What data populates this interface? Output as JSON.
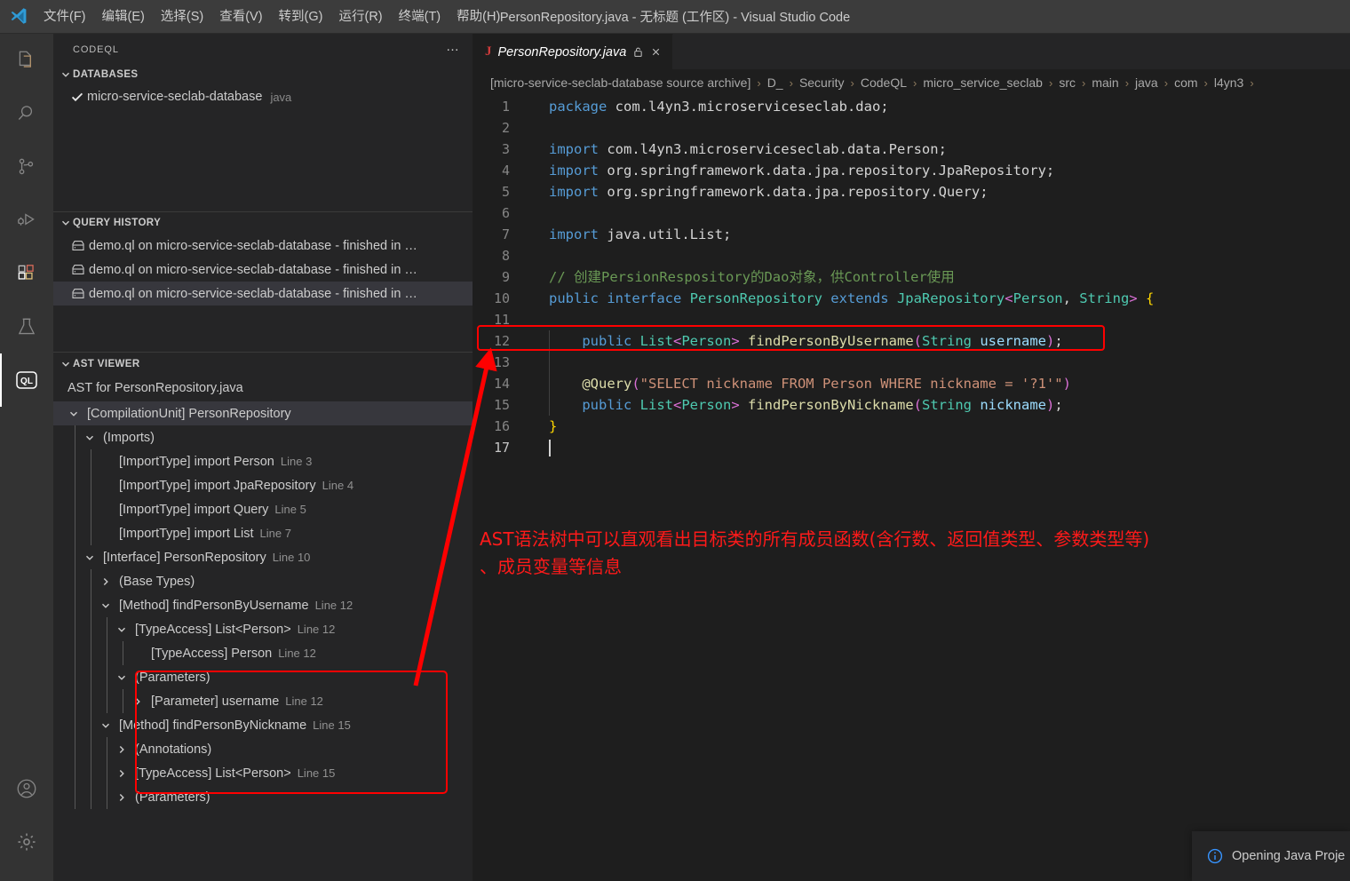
{
  "titlebar": {
    "logo_icon": "vscode-logo-icon",
    "menus": [
      {
        "label": "文件(F)",
        "name": "menu-file"
      },
      {
        "label": "编辑(E)",
        "name": "menu-edit"
      },
      {
        "label": "选择(S)",
        "name": "menu-selection"
      },
      {
        "label": "查看(V)",
        "name": "menu-view"
      },
      {
        "label": "转到(G)",
        "name": "menu-go"
      },
      {
        "label": "运行(R)",
        "name": "menu-run"
      },
      {
        "label": "终端(T)",
        "name": "menu-terminal"
      },
      {
        "label": "帮助(H)",
        "name": "menu-help"
      }
    ],
    "title": "PersonRepository.java - 无标题 (工作区) - Visual Studio Code"
  },
  "activitybar": {
    "items": [
      {
        "icon": "explorer-files-icon",
        "active": false
      },
      {
        "icon": "search-icon",
        "active": false
      },
      {
        "icon": "source-control-branch-icon",
        "active": false
      },
      {
        "icon": "run-and-debug-icon",
        "active": false
      },
      {
        "icon": "extensions-icon",
        "active": false
      },
      {
        "icon": "testing-beaker-icon",
        "active": false
      },
      {
        "icon": "codeql-icon",
        "active": true
      }
    ],
    "bottom_items": [
      {
        "icon": "account-icon"
      },
      {
        "icon": "settings-gear-icon"
      }
    ]
  },
  "sidebar": {
    "title": "CODEQL",
    "more_actions": "…",
    "databases": {
      "header": "DATABASES",
      "items": [
        {
          "name": "micro-service-seclab-database",
          "language": "java",
          "selected": true
        }
      ]
    },
    "query_history": {
      "header": "QUERY HISTORY",
      "items": [
        {
          "label": "demo.ql on micro-service-seclab-database - finished in …",
          "selected": false
        },
        {
          "label": "demo.ql on micro-service-seclab-database - finished in …",
          "selected": false
        },
        {
          "label": "demo.ql on micro-service-seclab-database - finished in …",
          "selected": true
        }
      ]
    },
    "ast_viewer": {
      "header": "AST VIEWER",
      "subtitle": "AST for PersonRepository.java",
      "nodes": [
        {
          "chev": "down",
          "indent": 0,
          "label": "[CompilationUnit] PersonRepository",
          "line": "",
          "selected": true
        },
        {
          "chev": "down",
          "indent": 1,
          "label": "(Imports)",
          "line": ""
        },
        {
          "chev": "none",
          "indent": 2,
          "label": "[ImportType] import Person",
          "line": "Line 3"
        },
        {
          "chev": "none",
          "indent": 2,
          "label": "[ImportType] import JpaRepository",
          "line": "Line 4"
        },
        {
          "chev": "none",
          "indent": 2,
          "label": "[ImportType] import Query",
          "line": "Line 5"
        },
        {
          "chev": "none",
          "indent": 2,
          "label": "[ImportType] import List",
          "line": "Line 7"
        },
        {
          "chev": "down",
          "indent": 1,
          "label": "[Interface] PersonRepository",
          "line": "Line 10"
        },
        {
          "chev": "right",
          "indent": 2,
          "label": "(Base Types)",
          "line": ""
        },
        {
          "chev": "down",
          "indent": 2,
          "label": "[Method] findPersonByUsername",
          "line": "Line 12"
        },
        {
          "chev": "down",
          "indent": 3,
          "label": "[TypeAccess] List<Person>",
          "line": "Line 12"
        },
        {
          "chev": "none",
          "indent": 4,
          "label": "[TypeAccess] Person",
          "line": "Line 12"
        },
        {
          "chev": "down",
          "indent": 3,
          "label": "(Parameters)",
          "line": ""
        },
        {
          "chev": "right",
          "indent": 4,
          "label": "[Parameter] username",
          "line": "Line 12"
        },
        {
          "chev": "down",
          "indent": 2,
          "label": "[Method] findPersonByNickname",
          "line": "Line 15"
        },
        {
          "chev": "right",
          "indent": 3,
          "label": "(Annotations)",
          "line": ""
        },
        {
          "chev": "right",
          "indent": 3,
          "label": "[TypeAccess] List<Person>",
          "line": "Line 15"
        },
        {
          "chev": "right",
          "indent": 3,
          "label": "(Parameters)",
          "line": ""
        }
      ]
    }
  },
  "editor": {
    "tab": {
      "label": "PersonRepository.java",
      "file_icon": "java-file-icon",
      "pin_icon": "lock-icon",
      "close_icon": "close-icon"
    },
    "breadcrumb": [
      "[micro-service-seclab-database source archive]",
      "D_",
      "Security",
      "CodeQL",
      "micro_service_seclab",
      "src",
      "main",
      "java",
      "com",
      "l4yn3"
    ],
    "breadcrumb_separator": "›",
    "code": {
      "first_line": 1,
      "last_line": 17,
      "lines": [
        {
          "n": 1,
          "segments": [
            {
              "t": "package ",
              "c": "kw"
            },
            {
              "t": "com.l4yn3.microserviceseclab.dao;",
              "c": "plain"
            }
          ]
        },
        {
          "n": 2,
          "segments": []
        },
        {
          "n": 3,
          "segments": [
            {
              "t": "import ",
              "c": "kw"
            },
            {
              "t": "com.l4yn3.microserviceseclab.data.Person;",
              "c": "plain"
            }
          ]
        },
        {
          "n": 4,
          "segments": [
            {
              "t": "import ",
              "c": "kw"
            },
            {
              "t": "org.springframework.data.jpa.repository.JpaRepository;",
              "c": "plain"
            }
          ]
        },
        {
          "n": 5,
          "segments": [
            {
              "t": "import ",
              "c": "kw"
            },
            {
              "t": "org.springframework.data.jpa.repository.Query;",
              "c": "plain"
            }
          ]
        },
        {
          "n": 6,
          "segments": []
        },
        {
          "n": 7,
          "segments": [
            {
              "t": "import ",
              "c": "kw"
            },
            {
              "t": "java.util.List;",
              "c": "plain"
            }
          ]
        },
        {
          "n": 8,
          "segments": []
        },
        {
          "n": 9,
          "segments": [
            {
              "t": "// 创建PersionRespository的Dao对象，供Controller使用",
              "c": "cmt"
            }
          ]
        },
        {
          "n": 10,
          "segments": [
            {
              "t": "public ",
              "c": "kw"
            },
            {
              "t": "interface ",
              "c": "kw"
            },
            {
              "t": "PersonRepository ",
              "c": "cls"
            },
            {
              "t": "extends ",
              "c": "kw"
            },
            {
              "t": "JpaRepository",
              "c": "cls"
            },
            {
              "t": "<",
              "c": "brk"
            },
            {
              "t": "Person",
              "c": "cls"
            },
            {
              "t": ", ",
              "c": "punc"
            },
            {
              "t": "String",
              "c": "cls"
            },
            {
              "t": ">",
              "c": "brk"
            },
            {
              "t": " ",
              "c": "plain"
            },
            {
              "t": "{",
              "c": "brk2"
            }
          ]
        },
        {
          "n": 11,
          "segments": []
        },
        {
          "n": 12,
          "segments": [
            {
              "t": "    ",
              "c": "plain"
            },
            {
              "t": "public ",
              "c": "kw"
            },
            {
              "t": "List",
              "c": "cls"
            },
            {
              "t": "<",
              "c": "brk"
            },
            {
              "t": "Person",
              "c": "cls"
            },
            {
              "t": ">",
              "c": "brk"
            },
            {
              "t": " ",
              "c": "plain"
            },
            {
              "t": "findPersonByUsername",
              "c": "fn"
            },
            {
              "t": "(",
              "c": "brk"
            },
            {
              "t": "String ",
              "c": "cls"
            },
            {
              "t": "username",
              "c": "var"
            },
            {
              "t": ")",
              "c": "brk"
            },
            {
              "t": ";",
              "c": "punc"
            }
          ]
        },
        {
          "n": 13,
          "segments": []
        },
        {
          "n": 14,
          "segments": [
            {
              "t": "    ",
              "c": "plain"
            },
            {
              "t": "@Query",
              "c": "ann"
            },
            {
              "t": "(",
              "c": "brk"
            },
            {
              "t": "\"SELECT nickname FROM Person WHERE nickname = '?1'\"",
              "c": "str"
            },
            {
              "t": ")",
              "c": "brk"
            }
          ]
        },
        {
          "n": 15,
          "segments": [
            {
              "t": "    ",
              "c": "plain"
            },
            {
              "t": "public ",
              "c": "kw"
            },
            {
              "t": "List",
              "c": "cls"
            },
            {
              "t": "<",
              "c": "brk"
            },
            {
              "t": "Person",
              "c": "cls"
            },
            {
              "t": ">",
              "c": "brk"
            },
            {
              "t": " ",
              "c": "plain"
            },
            {
              "t": "findPersonByNickname",
              "c": "fn"
            },
            {
              "t": "(",
              "c": "brk"
            },
            {
              "t": "String ",
              "c": "cls"
            },
            {
              "t": "nickname",
              "c": "var"
            },
            {
              "t": ")",
              "c": "brk"
            },
            {
              "t": ";",
              "c": "punc"
            }
          ]
        },
        {
          "n": 16,
          "segments": [
            {
              "t": "}",
              "c": "brk2"
            }
          ]
        },
        {
          "n": 17,
          "segments": [],
          "cursor": true
        }
      ]
    }
  },
  "annotations": {
    "color": "#ff1a1a",
    "note_line1": "AST语法树中可以直观看出目标类的所有成员函数(含行数、返回值类型、参数类型等)",
    "note_line2": "、成员变量等信息"
  },
  "notification": {
    "icon": "info-circle-icon",
    "message": "Opening Java Proje"
  }
}
